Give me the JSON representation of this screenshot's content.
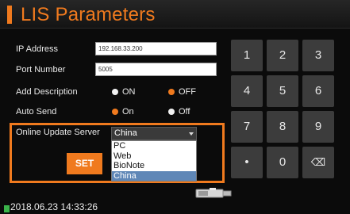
{
  "title": "LIS Parameters",
  "form": {
    "ip_label": "IP Address",
    "ip_value": "192.168.33.200",
    "port_label": "Port Number",
    "port_value": "5005",
    "add_desc_label": "Add Description",
    "add_desc_on": "ON",
    "add_desc_off": "OFF",
    "auto_send_label": "Auto Send",
    "auto_send_on": "On",
    "auto_send_off": "Off"
  },
  "server": {
    "label": "Online Update Server",
    "selected": "China",
    "options": [
      "PC",
      "Web",
      "BioNote",
      "China"
    ]
  },
  "set_button": "SET",
  "keypad": {
    "keys": [
      "1",
      "2",
      "3",
      "4",
      "5",
      "6",
      "7",
      "8",
      "9",
      "•",
      "0",
      "⌫"
    ]
  },
  "status": {
    "datetime": "2018.06.23  14:33:26"
  },
  "colors": {
    "accent": "#f07a1e",
    "selection": "#5f87b7",
    "status_ok": "#3bb34a"
  }
}
